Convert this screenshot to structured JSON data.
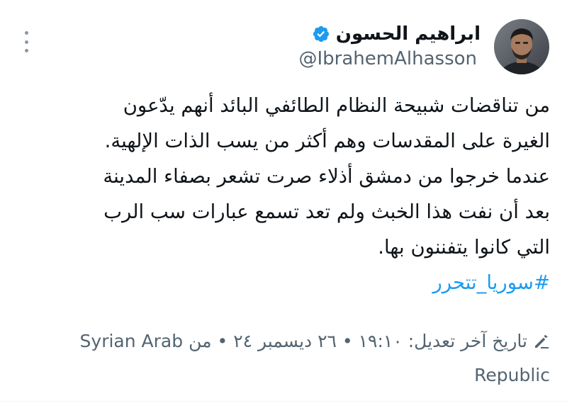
{
  "author": {
    "display_name": "ابراهيم الحسون",
    "handle": "@IbrahemAlhasson",
    "verified": true,
    "avatar_icon": "profile-photo"
  },
  "tweet": {
    "lines": [
      "من تناقضات شبيحة النظام الطائفي البائد أنهم يدّعون",
      "الغيرة على المقدسات وهم أكثر من يسب الذات الإلهية.",
      "عندما خرجوا من دمشق أذلاء صرت تشعر بصفاء المدينة",
      "بعد أن نفت هذا الخبث ولم تعد تسمع عبارات سب الرب",
      "التي كانوا يتفننون بها."
    ],
    "hashtag": "#سوريا_تتحرر"
  },
  "footer": {
    "edit_icon": "pencil-icon",
    "edited_text": "تاريخ آخر تعديل: ١٩:١٠ • ٢٦ ديسمبر ٢٤ • من",
    "location_part1": "Syrian Arab",
    "location_part2": "Republic"
  },
  "colors": {
    "text": "#0f1419",
    "secondary": "#536471",
    "link": "#1d9bf0",
    "verified": "#1d9bf0"
  }
}
